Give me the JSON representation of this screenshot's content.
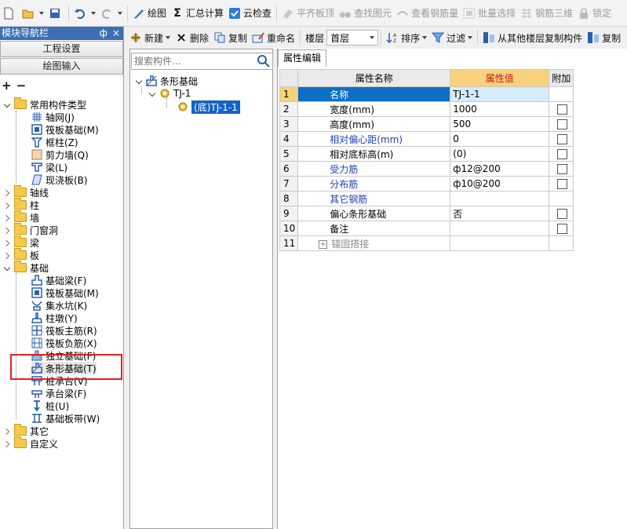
{
  "toolbar": {
    "draw_label": "绘图",
    "sum_label": "汇总计算",
    "cloud_label": "云检查",
    "flush_label": "平齐板顶",
    "find_label": "查找图元",
    "view_rebar_label": "查看钢筋量",
    "batch_label": "批量选择",
    "rebar3d_label": "钢筋三维",
    "lock_label": "锁定"
  },
  "toolbar2": {
    "new_label": "新建",
    "delete_label": "删除",
    "copy_label": "复制",
    "rename_label": "重命名",
    "floor_label": "楼层",
    "floor_value": "首层",
    "sort_label": "排序",
    "filter_label": "过滤",
    "copy_from_floor_label": "从其他楼层复制构件",
    "copy2_label": "复制"
  },
  "nav": {
    "title": "模块导航栏",
    "pin": "ф",
    "close": "×",
    "project_settings": "工程设置",
    "drawing_input": "绘图输入",
    "expand_all": "+",
    "collapse_all": "−"
  },
  "tree": {
    "common": "常用构件类型",
    "common_items": [
      "轴网(J)",
      "筏板基础(M)",
      "框柱(Z)",
      "剪力墙(Q)",
      "梁(L)",
      "现浇板(B)"
    ],
    "axis": "轴线",
    "column": "柱",
    "wall": "墙",
    "door_window": "门窗洞",
    "beam": "梁",
    "slab": "板",
    "foundation": "基础",
    "foundation_items": [
      "基础梁(F)",
      "筏板基础(M)",
      "集水坑(K)",
      "柱墩(Y)",
      "筏板主筋(R)",
      "筏板负筋(X)",
      "独立基础(F)",
      "条形基础(T)",
      "桩承台(V)",
      "承台梁(F)",
      "桩(U)",
      "基础板带(W)"
    ],
    "other": "其它",
    "custom": "自定义"
  },
  "search": {
    "placeholder": "搜索构件..."
  },
  "component_tree": {
    "root": "条形基础",
    "child": "TJ-1",
    "leaf": "(底)TJ-1-1"
  },
  "property_tab": "属性编辑",
  "grid": {
    "headers": {
      "name": "属性名称",
      "value": "属性值",
      "extra": "附加"
    },
    "rows": [
      {
        "num": "1",
        "name": "名称",
        "value": "TJ-1-1"
      },
      {
        "num": "2",
        "name": "宽度(mm)",
        "value": "1000"
      },
      {
        "num": "3",
        "name": "高度(mm)",
        "value": "500"
      },
      {
        "num": "4",
        "name": "相对偏心距(mm)",
        "value": "0"
      },
      {
        "num": "5",
        "name": "相对底标高(m)",
        "value": "(0)"
      },
      {
        "num": "6",
        "name": "受力筋",
        "value": "ф12@200"
      },
      {
        "num": "7",
        "name": "分布筋",
        "value": "ф10@200"
      },
      {
        "num": "8",
        "name": "其它钢筋",
        "value": ""
      },
      {
        "num": "9",
        "name": "偏心条形基础",
        "value": "否"
      },
      {
        "num": "10",
        "name": "备注",
        "value": ""
      },
      {
        "num": "11",
        "name": "锚固搭接",
        "value": ""
      }
    ],
    "expand_symbol": "+"
  },
  "colors": {
    "accent_blue": "#0b6fc6",
    "header_orange": "#f7d27a",
    "highlight_red": "#e02020",
    "blue_text": "#1e3fb4"
  }
}
